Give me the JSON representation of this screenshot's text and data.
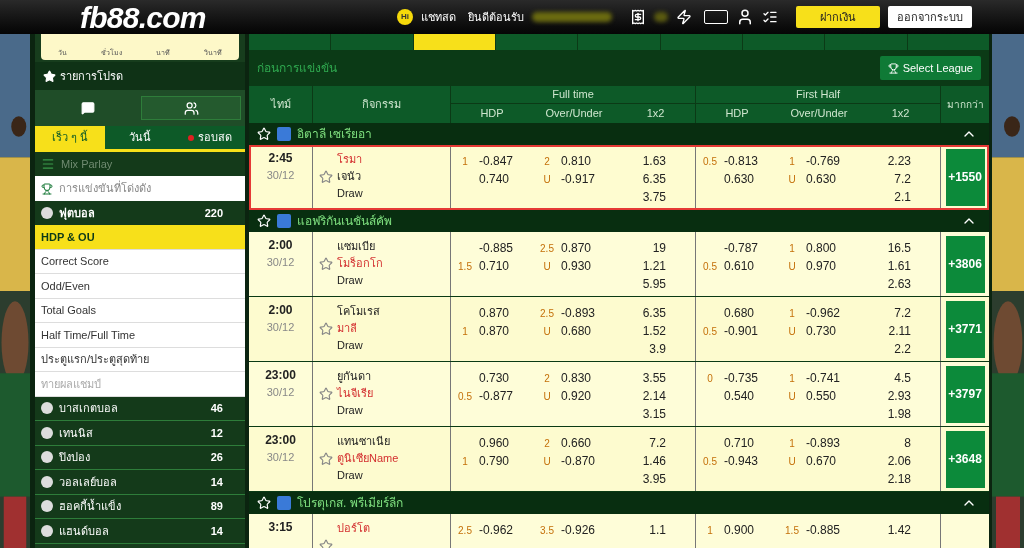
{
  "header": {
    "logo": "fb88.com",
    "chat": {
      "icon": "Hi",
      "label": "แชทสด"
    },
    "welcome": "ยินดีต้อนรับ",
    "deposit": "ฝากเงิน",
    "logout": "ออกจากระบบ"
  },
  "sidebar": {
    "countdown_labels": [
      "วัน",
      "ชั่วโมง",
      "นาที",
      "วินาที"
    ],
    "favorites": "รายการโปรด",
    "view_buttons": [
      {
        "selected": false
      },
      {
        "selected": true
      }
    ],
    "tabs": [
      {
        "label": "เร็ว ๆ นี้",
        "selected": true,
        "live": false
      },
      {
        "label": "วันนี้",
        "selected": false,
        "live": false
      },
      {
        "label": "รอบสด",
        "selected": false,
        "live": true
      }
    ],
    "mix_parlay": "Mix Parlay",
    "popular": "การแข่งขันที่โด่งดัง",
    "football": {
      "label": "ฟุตบอล",
      "count": "220"
    },
    "markets": [
      {
        "label": "HDP & OU",
        "selected": true,
        "disabled": false
      },
      {
        "label": "Correct Score",
        "selected": false,
        "disabled": false
      },
      {
        "label": "Odd/Even",
        "selected": false,
        "disabled": false
      },
      {
        "label": "Total Goals",
        "selected": false,
        "disabled": false
      },
      {
        "label": "Half Time/Full Time",
        "selected": false,
        "disabled": false
      },
      {
        "label": "ประตูแรก/ประตูสุดท้าย",
        "selected": false,
        "disabled": false
      },
      {
        "label": "ทายผลแชมป์",
        "selected": false,
        "disabled": true
      }
    ],
    "sports": [
      {
        "label": "บาสเกตบอล",
        "count": "46"
      },
      {
        "label": "เทนนิส",
        "count": "12"
      },
      {
        "label": "ปิงปอง",
        "count": "26"
      },
      {
        "label": "วอลเลย์บอล",
        "count": "14"
      },
      {
        "label": "ฮอคกี้น้ำแข็ง",
        "count": "89"
      },
      {
        "label": "แฮนด์บอล",
        "count": "14"
      }
    ]
  },
  "date_tabs": [
    {
      "selected": false
    },
    {
      "selected": false
    },
    {
      "selected": true
    },
    {
      "selected": false
    },
    {
      "selected": false
    },
    {
      "selected": false
    },
    {
      "selected": false
    },
    {
      "selected": false
    },
    {
      "selected": false
    }
  ],
  "section_title": "ก่อนการแข่งขัน",
  "select_league": "Select League",
  "columns": {
    "time": "ไทม์",
    "event": "กิจกรรม",
    "full_time": "Full time",
    "first_half": "First Half",
    "more": "มากกว่า",
    "sub": [
      "HDP",
      "Over/Under",
      "1x2",
      "HDP",
      "Over/Under",
      "1x2"
    ]
  },
  "leagues": [
    {
      "name": "อิตาลี เซเรียอา",
      "matches": [
        {
          "time": "2:45",
          "date": "30/12",
          "selected": true,
          "teams": [
            {
              "name": "โรมา",
              "favorite": true
            },
            {
              "name": "เจนัว",
              "favorite": false
            },
            {
              "name": "Draw",
              "favorite": false
            }
          ],
          "ft": {
            "hdp": [
              {
                "line": "1",
                "odds": "-0.847"
              },
              {
                "odds": "0.740"
              }
            ],
            "ou": [
              {
                "line": "2",
                "odds": "0.810"
              },
              {
                "line": "U",
                "odds": "-0.917"
              }
            ],
            "x12": [
              "1.63",
              "6.35",
              "3.75"
            ]
          },
          "fh": {
            "hdp": [
              {
                "line": "0.5",
                "odds": "-0.813"
              },
              {
                "odds": "0.630"
              }
            ],
            "ou": [
              {
                "line": "1",
                "odds": "-0.769"
              },
              {
                "line": "U",
                "odds": "0.630"
              }
            ],
            "x12": [
              "2.23",
              "7.2",
              "2.1"
            ]
          },
          "more": "+1550"
        }
      ]
    },
    {
      "name": "แอฟริกันเนชันส์คัพ",
      "matches": [
        {
          "time": "2:00",
          "date": "30/12",
          "selected": false,
          "teams": [
            {
              "name": "แซมเบีย",
              "favorite": false
            },
            {
              "name": "โมร็อกโก",
              "favorite": true
            },
            {
              "name": "Draw",
              "favorite": false
            }
          ],
          "ft": {
            "hdp": [
              {
                "odds": "-0.885"
              },
              {
                "line": "1.5",
                "odds": "0.710"
              }
            ],
            "ou": [
              {
                "line": "2.5",
                "odds": "0.870"
              },
              {
                "line": "U",
                "odds": "0.930"
              }
            ],
            "x12": [
              "19",
              "1.21",
              "5.95"
            ]
          },
          "fh": {
            "hdp": [
              {
                "odds": "-0.787"
              },
              {
                "line": "0.5",
                "odds": "0.610"
              }
            ],
            "ou": [
              {
                "line": "1",
                "odds": "0.800"
              },
              {
                "line": "U",
                "odds": "0.970"
              }
            ],
            "x12": [
              "16.5",
              "1.61",
              "2.63"
            ]
          },
          "more": "+3806"
        },
        {
          "time": "2:00",
          "date": "30/12",
          "selected": false,
          "teams": [
            {
              "name": "โคโมเรส",
              "favorite": false
            },
            {
              "name": "มาลี",
              "favorite": true
            },
            {
              "name": "Draw",
              "favorite": false
            }
          ],
          "ft": {
            "hdp": [
              {
                "odds": "0.870"
              },
              {
                "line": "1",
                "odds": "0.870"
              }
            ],
            "ou": [
              {
                "line": "2.5",
                "odds": "-0.893"
              },
              {
                "line": "U",
                "odds": "0.680"
              }
            ],
            "x12": [
              "6.35",
              "1.52",
              "3.9"
            ]
          },
          "fh": {
            "hdp": [
              {
                "odds": "0.680"
              },
              {
                "line": "0.5",
                "odds": "-0.901"
              }
            ],
            "ou": [
              {
                "line": "1",
                "odds": "-0.962"
              },
              {
                "line": "U",
                "odds": "0.730"
              }
            ],
            "x12": [
              "7.2",
              "2.11",
              "2.2"
            ]
          },
          "more": "+3771"
        },
        {
          "time": "23:00",
          "date": "30/12",
          "selected": false,
          "teams": [
            {
              "name": "ยูกันดา",
              "favorite": false
            },
            {
              "name": "ไนจีเรีย",
              "favorite": true
            },
            {
              "name": "Draw",
              "favorite": false
            }
          ],
          "ft": {
            "hdp": [
              {
                "odds": "0.730"
              },
              {
                "line": "0.5",
                "odds": "-0.877"
              }
            ],
            "ou": [
              {
                "line": "2",
                "odds": "0.830"
              },
              {
                "line": "U",
                "odds": "0.920"
              }
            ],
            "x12": [
              "3.55",
              "2.14",
              "3.15"
            ]
          },
          "fh": {
            "hdp": [
              {
                "line": "0",
                "odds": "-0.735"
              },
              {
                "odds": "0.540"
              }
            ],
            "ou": [
              {
                "line": "1",
                "odds": "-0.741"
              },
              {
                "line": "U",
                "odds": "0.550"
              }
            ],
            "x12": [
              "4.5",
              "2.93",
              "1.98"
            ]
          },
          "more": "+3797"
        },
        {
          "time": "23:00",
          "date": "30/12",
          "selected": false,
          "teams": [
            {
              "name": "แทนซาเนีย",
              "favorite": false
            },
            {
              "name": "ตูนิเซียName",
              "favorite": true
            },
            {
              "name": "Draw",
              "favorite": false
            }
          ],
          "ft": {
            "hdp": [
              {
                "odds": "0.960"
              },
              {
                "line": "1",
                "odds": "0.790"
              }
            ],
            "ou": [
              {
                "line": "2",
                "odds": "0.660"
              },
              {
                "line": "U",
                "odds": "-0.870"
              }
            ],
            "x12": [
              "7.2",
              "1.46",
              "3.95"
            ]
          },
          "fh": {
            "hdp": [
              {
                "odds": "0.710"
              },
              {
                "line": "0.5",
                "odds": "-0.943"
              }
            ],
            "ou": [
              {
                "line": "1",
                "odds": "-0.893"
              },
              {
                "line": "U",
                "odds": "0.670"
              }
            ],
            "x12": [
              "8",
              "2.06",
              "2.18"
            ]
          },
          "more": "+3648"
        }
      ]
    },
    {
      "name": "โปรตุเกส. พรีเมียร์ลีก",
      "matches": [
        {
          "time": "3:15",
          "selected": false,
          "teams": [
            {
              "name": "ปอร์โต",
              "favorite": true
            }
          ],
          "ft": {
            "hdp": [
              {
                "line": "2.5",
                "odds": "-0.962"
              }
            ],
            "ou": [
              {
                "line": "3.5",
                "odds": "-0.926"
              }
            ],
            "x12": [
              "1.1"
            ]
          },
          "fh": {
            "hdp": [
              {
                "line": "1",
                "odds": "0.900"
              }
            ],
            "ou": [
              {
                "line": "1.5",
                "odds": "-0.885"
              }
            ],
            "x12": [
              "1.42"
            ]
          }
        }
      ]
    }
  ]
}
